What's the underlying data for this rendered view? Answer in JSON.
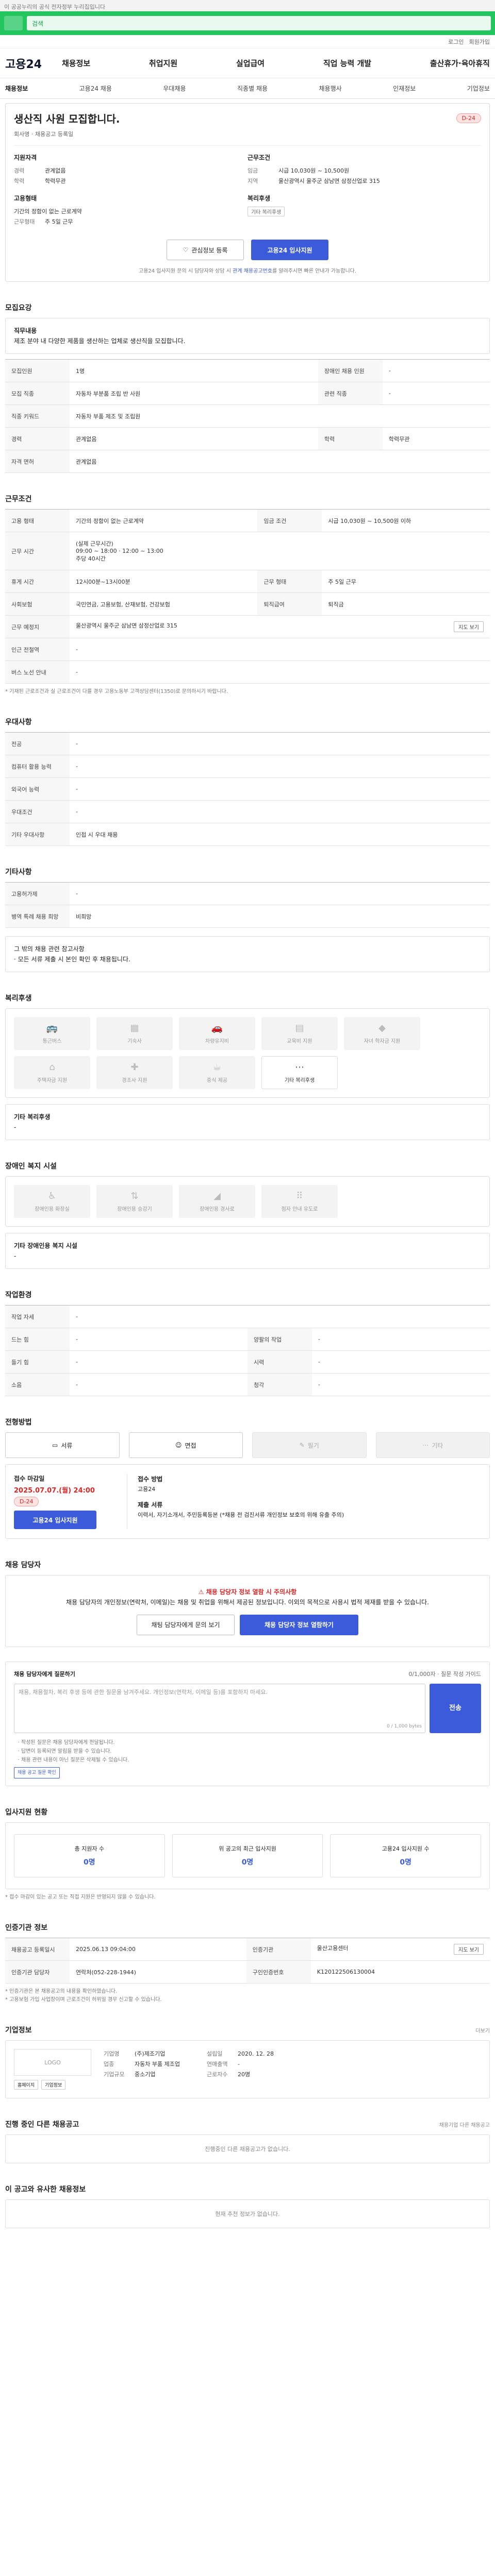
{
  "topbar": {
    "text": "이 공공누리의 공식 전자정부 누리집입니다"
  },
  "search": {
    "placeholder": "검색"
  },
  "util": {
    "login": "로그인",
    "join": "회원가입"
  },
  "brand": "고용24",
  "gnb": [
    "채용정보",
    "취업지원",
    "실업급여",
    "직업 능력 개발",
    "출산휴가·육아휴직"
  ],
  "subnav": [
    "채용정보",
    "고용24 채용",
    "우대채용",
    "직종별 채용",
    "채용행사",
    "인재정보",
    "기업정보"
  ],
  "job": {
    "title": "생산직 사원 모집합니다.",
    "dday": "D-24",
    "company_sub": "회사명 · 채용공고 등록일",
    "applicant_h": "지원자격",
    "career_k": "경력",
    "career_v": "관계없음",
    "edu_k": "학력",
    "edu_v": "학력무관",
    "emp_h": "고용형태",
    "emp_type": "기간의 정함이 없는 근로계약",
    "work_k": "근무형태",
    "work_v": "주 5일 근무",
    "cond_h": "근무조건",
    "wage_k": "임금",
    "wage_v": "시급 10,030원 ~ 10,500원",
    "loc_k": "지역",
    "loc_v": "울산광역시 울주군 삼남면 삼정산업로 315",
    "welfare_h": "복리후생",
    "welfare_tag": "기타 복리후생"
  },
  "actions": {
    "scrap": "관심정보 등록",
    "apply": "고용24 입사지원"
  },
  "notice": {
    "text": "고용24 입사지원 문의 시 담당자와 상담 시 ",
    "link": "관계 채용공고번호",
    "tail": "를 알려주시면 빠른 안내가 가능합니다."
  },
  "recruit": {
    "title": "모집요강",
    "duty_label": "직무내용",
    "duty": "제조 분야 내 다양한 제품을 생산하는 업체로 생산직을 모집합니다.",
    "rows": [
      {
        "k": "모집인원",
        "v": "1명",
        "k2": "장애인 채용 인원",
        "v2": "-"
      },
      {
        "k": "모집 직종",
        "v": "자동차 부분품 조립 반 사원",
        "k2": "관련 직종",
        "v2": "-"
      },
      {
        "k": "직종 키워드",
        "v": "자동차 부품 제조 및 조립원"
      },
      {
        "k": "경력",
        "v": "관계없음",
        "k2": "학력",
        "v2": "학력무관"
      },
      {
        "k": "자격 면허",
        "v": "관계없음"
      }
    ]
  },
  "work": {
    "title": "근무조건",
    "rows": [
      {
        "k": "고용 형태",
        "v": "기간의 정함이 없는 근로계약",
        "k2": "임금 조건",
        "v2": "시급 10,030원 ~ 10,500원 이하"
      },
      {
        "k": "근무 시간",
        "v": "(실제 근무시간)|09:00 ~ 18:00 · 12:00 ~ 13:00|주당 40시간",
        "tall": true
      },
      {
        "k": "휴게 시간",
        "v": "12시00분~13시00분",
        "k2": "근무 형태",
        "v2": "주 5일 근무"
      },
      {
        "k": "사회보험",
        "v": "국민연금, 고용보험, 산재보험, 건강보험",
        "k2": "퇴직급여",
        "v2": "퇴직금"
      },
      {
        "k": "근무 예정지",
        "v": "울산광역시 울주군 삼남면 삼정산업로 315",
        "btn": "지도 보기"
      },
      {
        "k": "인근 전철역",
        "v": "-"
      },
      {
        "k": "버스 노선 안내",
        "v": "-"
      }
    ],
    "note": "* 기재된 근로조건과 실 근로조건이 다를 경우 고용노동부 고객상담센터(1350)로 문의하시기 바랍니다."
  },
  "pref": {
    "title": "우대사항",
    "rows": [
      {
        "k": "전공",
        "v": "-"
      },
      {
        "k": "컴퓨터 활용 능력",
        "v": "-"
      },
      {
        "k": "외국어 능력",
        "v": "-"
      },
      {
        "k": "우대조건",
        "v": "-"
      },
      {
        "k": "기타 우대사항",
        "v": "인접 시 우대 채용"
      }
    ]
  },
  "etc": {
    "title": "기타사항",
    "rows": [
      {
        "k": "고용허가제",
        "v": "-"
      },
      {
        "k": "병역 특례 채용 희망",
        "v": "비희망"
      }
    ],
    "extra_title": "그 밖의 채용 관련 참고사항",
    "extra_text": "· 모든 서류 제출 시 본인 확인 후 채용됩니다."
  },
  "welfare": {
    "title": "복리후생",
    "tiles": [
      {
        "label": "통근버스",
        "icon": "bus-icon"
      },
      {
        "label": "기숙사",
        "icon": "building-icon"
      },
      {
        "label": "차량유지비",
        "icon": "car-icon"
      },
      {
        "label": "교육비 지원",
        "icon": "book-icon"
      },
      {
        "label": "자녀 학자금 지원",
        "icon": "cap-icon"
      },
      {
        "label": "주택자금 지원",
        "icon": "house-icon"
      },
      {
        "label": "경조사 지원",
        "icon": "gift-icon"
      },
      {
        "label": "중식 제공",
        "icon": "meal-icon"
      },
      {
        "label": "기타 복리후생",
        "icon": "etc-icon",
        "on": true
      }
    ],
    "etc_title": "기타 복리후생",
    "etc_text": "-"
  },
  "disabled": {
    "title": "장애인 복지 시설",
    "tiles": [
      {
        "label": "장애인용 화장실",
        "icon": "wc-icon"
      },
      {
        "label": "장애인용 승강기",
        "icon": "elevator-icon"
      },
      {
        "label": "장애인용 경사로",
        "icon": "ramp-icon"
      },
      {
        "label": "점자 안내 유도로",
        "icon": "braille-icon"
      }
    ],
    "etc_title": "기타 장애인용 복지 시설",
    "etc_text": "-"
  },
  "env": {
    "title": "작업환경",
    "rows": [
      {
        "k": "작업 자세",
        "v": "-"
      },
      {
        "k": "드는 힘",
        "v": "-",
        "k2": "양팔의 작업",
        "v2": "-"
      },
      {
        "k": "들기 힘",
        "v": "-",
        "k2": "시력",
        "v2": "-"
      },
      {
        "k": "소음",
        "v": "-",
        "k2": "청각",
        "v2": "-"
      }
    ]
  },
  "process": {
    "title": "전형방법",
    "methods": [
      {
        "label": "서류",
        "icon": "doc-icon"
      },
      {
        "label": "면접",
        "icon": "people-icon"
      },
      {
        "label": "필기",
        "icon": "pen-icon",
        "off": true
      },
      {
        "label": "기타",
        "icon": "dots-icon",
        "off": true
      }
    ],
    "deadline_label": "접수 마감일",
    "deadline": "2025.07.07.(월) 24:00",
    "dday": "D-24",
    "apply": "고용24 입사지원",
    "method_label": "접수 방법",
    "method_v": "고용24",
    "docs_label": "제출 서류",
    "docs_v": "이력서, 자기소개서, 주민등록등본 (*채용 전 검진서류 개인정보 보호의 위해 유출 주의)"
  },
  "manager": {
    "title": "채용 담당자",
    "warn_title": "채용 담당자 정보 열람 시 주의사항",
    "warn_text": "채용 담당자의 개인정보(연락처, 이메일)는 채용 및 취업을 위해서 제공된 정보입니다. 이외의 목적으로 사용시 법적 제재를 받을 수 있습니다.",
    "btn_chat": "채팅 담당자에게 문의 보기",
    "btn_view": "채용 담당자 정보 열람하기"
  },
  "qna": {
    "title": "채용 담당자에게 질문하기",
    "right": "0/1,000자 · 질문 작성 가이드",
    "placeholder": "채용, 채용절차, 복리 후생 등에 관한 질문을 남겨주세요. 개인정보(연락처, 이메일 등)를 포함하지 마세요.",
    "count": "0 / 1,000 bytes",
    "send": "전송",
    "bullets": [
      "작성된 질문은 채용 담당자에게 전달됩니다.",
      "답변이 등록되면 알림을 받을 수 있습니다.",
      "채용 관련 내용이 아닌 질문은 삭제될 수 있습니다."
    ],
    "mini": "채용 공고 질문 확인"
  },
  "status": {
    "title": "입사지원 현황",
    "cards": [
      {
        "label": "총 지원자 수",
        "value": "0명"
      },
      {
        "label": "위 공고의 최근 입사지원",
        "value": "0명"
      },
      {
        "label": "고용24 입사지원 수",
        "value": "0명"
      }
    ],
    "note": "* 접수 마감이 있는 공고 또는 직접 지원은 반영되지 않을 수 있습니다."
  },
  "agency": {
    "title": "인증기관 정보",
    "rows": [
      {
        "k": "채용공고 등록일시",
        "v": "2025.06.13 09:04:00",
        "k2": "인증기관",
        "v2": "울산고용센터",
        "btn": "지도 보기"
      },
      {
        "k": "인증기관 담당자",
        "v": "연락처(052-228-1944)",
        "k2": "구인인증번호",
        "v2": "K120122506130004"
      }
    ],
    "notes": [
      "* 인증기관은 본 채용공고의 내용을 확인하였습니다.",
      "* 고용보험 가입 사업장이며 근로조건이 허위일 경우 신고할 수 있습니다."
    ]
  },
  "company": {
    "title": "기업정보",
    "more": "더보기",
    "logo": "LOGO",
    "links": [
      "홈페이지",
      "기업정보"
    ],
    "rows": [
      {
        "k": "기업명",
        "v": "(주)제조기업",
        "k2": "설립일",
        "v2": "2020. 12. 28"
      },
      {
        "k": "업종",
        "v": "자동차 부품 제조업",
        "k2": "연매출액",
        "v2": "-"
      },
      {
        "k": "기업규모",
        "v": "중소기업",
        "k2": "근로자수",
        "v2": "20명"
      }
    ]
  },
  "other": {
    "title": "진행 중인 다른 채용공고",
    "more": "채용기업 다른 채용공고",
    "empty": "진행중인 다른 채용공고가 없습니다."
  },
  "recommend": {
    "title": "이 공고와 유사한 채용정보",
    "empty": "현재 추천 정보가 없습니다."
  }
}
